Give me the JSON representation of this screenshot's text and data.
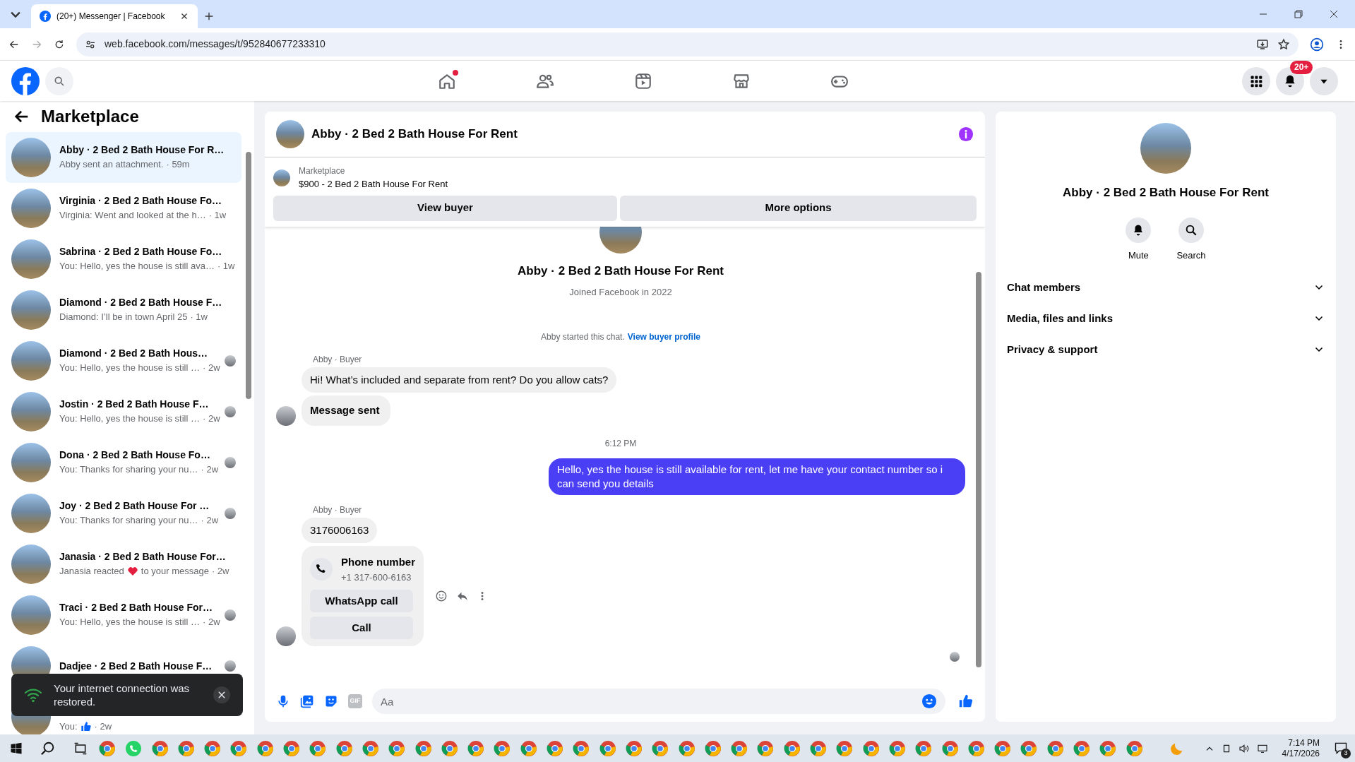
{
  "browser": {
    "tab_title": "(20+) Messenger | Facebook",
    "url": "web.facebook.com/messages/t/952840677233310"
  },
  "topnav": {
    "home_dot": true,
    "notification_badge": "20+"
  },
  "sidebar": {
    "title": "Marketplace"
  },
  "conversations": [
    {
      "kind": "text",
      "name": "Abby · 2 Bed 2 Bath House For R…",
      "preview": "Abby sent an attachment.",
      "time": "· 59m",
      "selected": true,
      "seen": false
    },
    {
      "kind": "text",
      "name": "Virginia · 2 Bed 2 Bath House Fo…",
      "preview": "Virginia: Went and looked at the h…",
      "time": "· 1w",
      "selected": false,
      "seen": false
    },
    {
      "kind": "text",
      "name": "Sabrina · 2 Bed 2 Bath House Fo…",
      "preview": "You: Hello, yes the house is still ava…",
      "time": "· 1w",
      "selected": false,
      "seen": false
    },
    {
      "kind": "text",
      "name": "Diamond · 2 Bed 2 Bath House F…",
      "preview": "Diamond: I’ll be in town April 25",
      "time": "· 1w",
      "selected": false,
      "seen": false
    },
    {
      "kind": "text",
      "name": "Diamond · 2 Bed 2 Bath Hous…",
      "preview": "You: Hello, yes the house is still …",
      "time": "· 2w",
      "selected": false,
      "seen": true
    },
    {
      "kind": "text",
      "name": "Jostin · 2 Bed 2 Bath House F…",
      "preview": "You: Hello, yes the house is still …",
      "time": "· 2w",
      "selected": false,
      "seen": true
    },
    {
      "kind": "text",
      "name": "Dona · 2 Bed 2 Bath House Fo…",
      "preview": "You: Thanks for sharing your nu…",
      "time": "· 2w",
      "selected": false,
      "seen": true
    },
    {
      "kind": "text",
      "name": "Joy · 2 Bed 2 Bath House For …",
      "preview": "You: Thanks for sharing your nu…",
      "time": "· 2w",
      "selected": false,
      "seen": true
    },
    {
      "kind": "heart",
      "name": "Janasia · 2 Bed 2 Bath House For…",
      "preview": "Janasia reacted",
      "preview_end": "to your message",
      "time": "· 2w",
      "selected": false,
      "seen": false
    },
    {
      "kind": "text",
      "name": "Traci · 2 Bed 2 Bath House For…",
      "preview": "You: Hello, yes the house is still …",
      "time": "· 2w",
      "selected": false,
      "seen": true
    },
    {
      "name": "Dadjee · 2 Bed 2 Bath House F…",
      "selected": false,
      "seen": true
    },
    {
      "kind": "like",
      "preview": "You:",
      "time": "· 2w",
      "selected": false,
      "seen": false
    }
  ],
  "toast": {
    "text": "Your internet connection was restored."
  },
  "chat": {
    "title": "Abby · 2 Bed 2 Bath House For Rent"
  },
  "listing": {
    "label": "Marketplace",
    "title": "$900 - 2 Bed 2 Bath House For Rent",
    "buttons": [
      "View buyer",
      "More options"
    ]
  },
  "intro": {
    "name": "Abby · 2 Bed 2 Bath House For Rent",
    "joined": "Joined Facebook in 2022",
    "started": "Abby started this chat.",
    "link": "View buyer profile"
  },
  "messages": [
    {
      "kind": "sender",
      "text": "Abby · Buyer"
    },
    {
      "kind": "incoming",
      "text": "Hi! What’s included and separate from rent? Do you allow cats?",
      "bold": false,
      "avatar": false
    },
    {
      "kind": "incoming",
      "text": "Message sent",
      "bold": true,
      "avatar": true
    },
    {
      "kind": "time",
      "text": "6:12 PM"
    },
    {
      "kind": "outgoing",
      "text": "Hello, yes the house is still available for rent, let me have your contact number so i can send you  details"
    },
    {
      "kind": "sender",
      "text": "Abby · Buyer"
    },
    {
      "kind": "incoming",
      "text": "3176006163",
      "bold": false,
      "avatar": false
    },
    {
      "kind": "contact",
      "title": "Phone number",
      "number": "+1 317-600-6163",
      "buttons": [
        "WhatsApp call",
        "Call"
      ],
      "avatar": true
    }
  ],
  "composer": {
    "gif": "GIF",
    "placeholder": "Aa"
  },
  "details": {
    "name": "Abby · 2 Bed 2 Bath House For Rent",
    "actions": [
      "Mute",
      "Search"
    ],
    "sections": [
      {
        "label": "Chat members",
        "expanded": false
      },
      {
        "label": "Media, files and links",
        "expanded": false
      },
      {
        "label": "Privacy & support",
        "expanded": false
      }
    ]
  },
  "taskbar": {
    "time": "7:14 PM",
    "date": "4/17/2026",
    "notifications": "3"
  }
}
